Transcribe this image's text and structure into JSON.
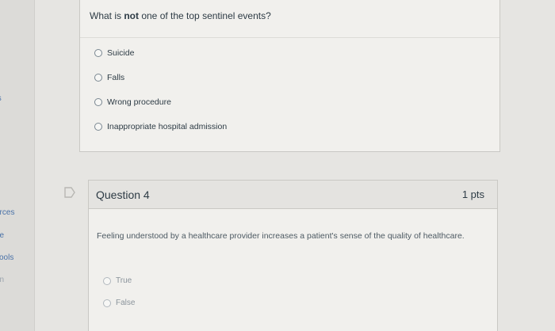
{
  "left_nav": {
    "items": [
      {
        "label": "ts",
        "dim": false
      },
      {
        "label": "urces",
        "dim": false
      },
      {
        "label": "de",
        "dim": false
      },
      {
        "label": "Tools",
        "dim": false
      },
      {
        "label": "on",
        "dim": true
      }
    ]
  },
  "question3": {
    "prompt_prefix": "What is ",
    "prompt_emphasis": "not",
    "prompt_suffix": " one of the top sentinel events?",
    "options": [
      "Suicide",
      "Falls",
      "Wrong procedure",
      "Inappropriate hospital admission"
    ]
  },
  "question4": {
    "title": "Question 4",
    "points": "1 pts",
    "text": "Feeling understood by a healthcare provider increases a patient's sense of the quality of healthcare.",
    "options": [
      "True",
      "False"
    ]
  },
  "icons": {
    "flag": "flag-icon",
    "radio": "radio-icon"
  },
  "colors": {
    "link": "#4a72a8",
    "text": "#2d3b45",
    "card_bg": "#f1f0ed",
    "header_bg": "#e4e3e0"
  }
}
